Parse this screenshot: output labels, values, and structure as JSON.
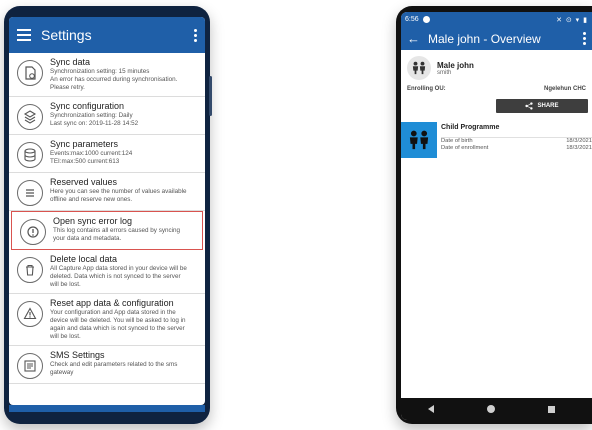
{
  "left": {
    "title": "Settings",
    "items": [
      {
        "title": "Sync data",
        "lines": [
          "Synchronization setting: 15 minutes",
          "An error has occurred during synchronisation.",
          "Please retry."
        ]
      },
      {
        "title": "Sync configuration",
        "lines": [
          "Synchronization setting: Daily",
          "Last sync on: 2019-11-28 14:52"
        ]
      },
      {
        "title": "Sync parameters",
        "lines": [
          "Events:max:1000 current:124",
          "TEI:max:500 current:613"
        ]
      },
      {
        "title": "Reserved values",
        "lines": [
          "Here you can see the number of values available",
          "offline and reserve new ones."
        ]
      },
      {
        "title": "Open sync error log",
        "lines": [
          "This log contains all errors caused by syncing",
          "your data and metadata."
        ]
      },
      {
        "title": "Delete local data",
        "lines": [
          "All Capture App data stored in your device will be",
          "deleted. Data which is not synced to the server",
          "will be lost."
        ]
      },
      {
        "title": "Reset app data & configuration",
        "lines": [
          "Your configuration and App data stored in the",
          "device will be deleted. You will be asked to log in",
          "again and data which is not synced to the server",
          "will be lost."
        ]
      },
      {
        "title": "SMS Settings",
        "lines": [
          "Check and edit parameters related to the sms",
          "gateway"
        ]
      }
    ],
    "selected_index": 4
  },
  "right": {
    "time": "6:56",
    "title": "Male john - Overview",
    "person_name": "Male john",
    "person_surname": "smith",
    "enrolling_label": "Enrolling OU:",
    "enrolling_value": "Ngelehun CHC",
    "share_label": "SHARE",
    "program_title": "Child Programme",
    "dob_label": "Date of birth",
    "dob_value": "18/3/2021",
    "enroll_date_label": "Date of enrollment",
    "enroll_date_value": "18/3/2021"
  },
  "colors": {
    "primary": "#1f5fa8",
    "program_icon_bg": "#1f8dd6",
    "selected_border": "#d9534f"
  }
}
